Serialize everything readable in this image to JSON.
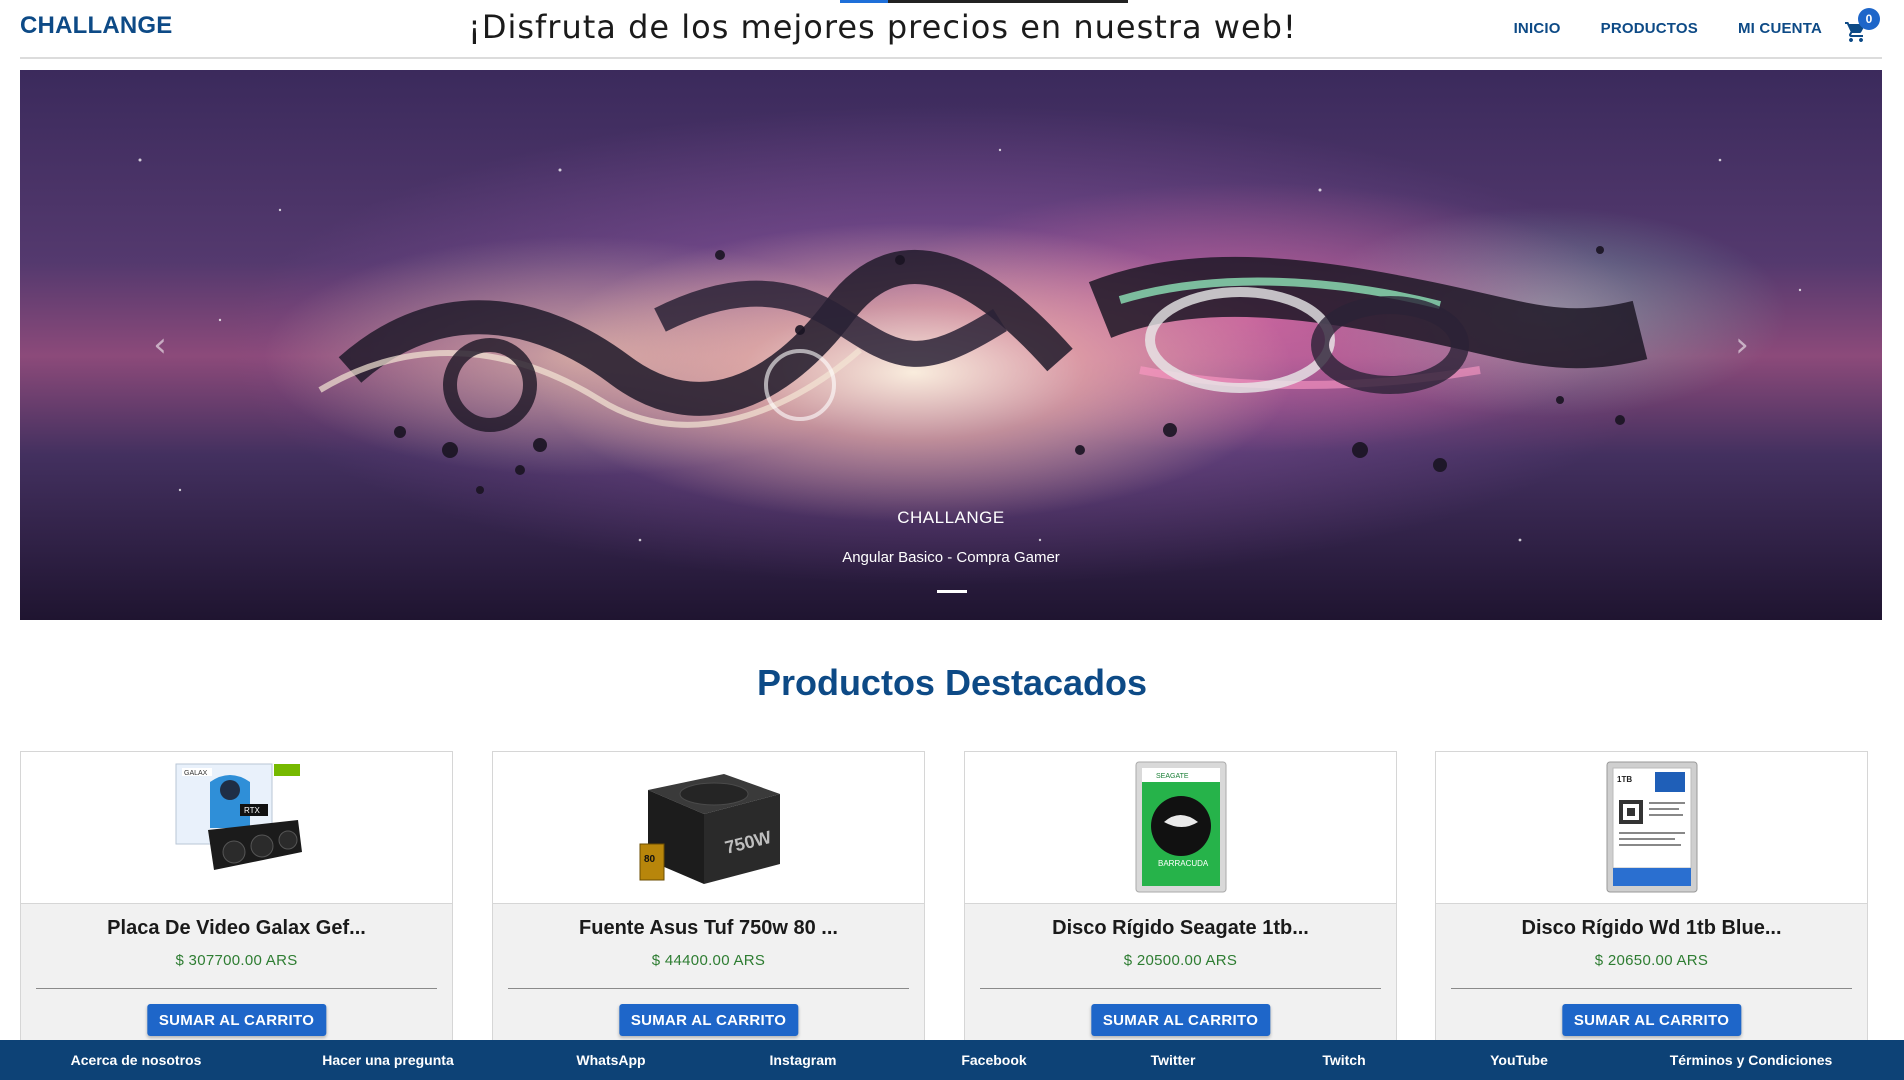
{
  "header": {
    "brand": "CHALLANGE",
    "promo": "¡Disfruta de los mejores precios en nuestra web!",
    "nav": [
      "INICIO",
      "PRODUCTOS",
      "MI CUENTA"
    ],
    "cart_count": "0"
  },
  "hero": {
    "caption_title": "CHALLANGE",
    "caption_subtitle": "Angular Basico - Compra Gamer",
    "prev_icon": "chevron-left-icon",
    "next_icon": "chevron-right-icon",
    "active_slide": 1,
    "slide_count": 1
  },
  "section": {
    "title": "Productos Destacados"
  },
  "products": [
    {
      "title": "Placa De Video Galax Gef...",
      "price": "$ 307700.00 ARS",
      "button": "SUMAR AL CARRITO",
      "image": "graphics-card-box"
    },
    {
      "title": "Fuente Asus Tuf 750w 80 ...",
      "price": "$ 44400.00 ARS",
      "button": "SUMAR AL CARRITO",
      "image": "power-supply"
    },
    {
      "title": "Disco Rígido Seagate 1tb...",
      "price": "$ 20500.00 ARS",
      "button": "SUMAR AL CARRITO",
      "image": "hard-drive-green"
    },
    {
      "title": "Disco Rígido Wd 1tb Blue...",
      "price": "$ 20650.00 ARS",
      "button": "SUMAR AL CARRITO",
      "image": "hard-drive-blue"
    }
  ],
  "footer": {
    "links": [
      "Acerca de nosotros",
      "Hacer una pregunta",
      "WhatsApp",
      "Instagram",
      "Facebook",
      "Twitter",
      "Twitch",
      "YouTube",
      "Términos y Condiciones"
    ]
  },
  "colors": {
    "brand": "#0d4a86",
    "button": "#1e66c9",
    "price": "#2e7d32",
    "footer": "#0d4276"
  }
}
